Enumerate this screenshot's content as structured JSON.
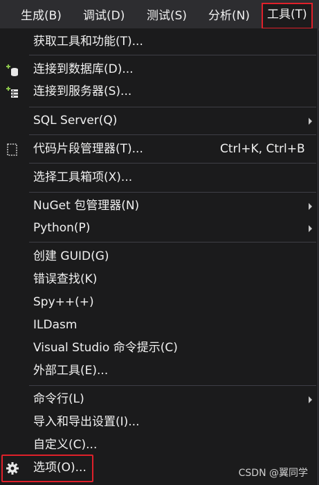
{
  "menubar": {
    "items": [
      "生成(B)",
      "调试(D)",
      "测试(S)",
      "分析(N)",
      "工具(T)"
    ]
  },
  "menu": {
    "items": [
      {
        "label": "获取工具和功能(T)..."
      },
      {
        "label": "连接到数据库(D)...",
        "icon": "database-connect-icon"
      },
      {
        "label": "连接到服务器(S)...",
        "icon": "server-connect-icon"
      },
      {
        "label": "SQL Server(Q)",
        "submenu": true
      },
      {
        "label": "代码片段管理器(T)...",
        "shortcut": "Ctrl+K, Ctrl+B",
        "icon": "code-snippet-icon"
      },
      {
        "label": "选择工具箱项(X)..."
      },
      {
        "label": "NuGet 包管理器(N)",
        "submenu": true
      },
      {
        "label": "Python(P)",
        "submenu": true
      },
      {
        "label": "创建 GUID(G)"
      },
      {
        "label": "错误查找(K)"
      },
      {
        "label": "Spy++(+)"
      },
      {
        "label": "ILDasm"
      },
      {
        "label": "Visual Studio 命令提示(C)"
      },
      {
        "label": "外部工具(E)..."
      },
      {
        "label": "命令行(L)",
        "submenu": true
      },
      {
        "label": "导入和导出设置(I)..."
      },
      {
        "label": "自定义(C)..."
      },
      {
        "label": "选项(O)...",
        "icon": "gear-icon"
      }
    ]
  },
  "watermark": "CSDN @翼同学",
  "colors": {
    "background": "#1b1b1c",
    "menubar": "#2d2d30",
    "highlight_border": "#e0202a",
    "separator": "#3f3f46",
    "icon_green": "#8ac34a"
  }
}
